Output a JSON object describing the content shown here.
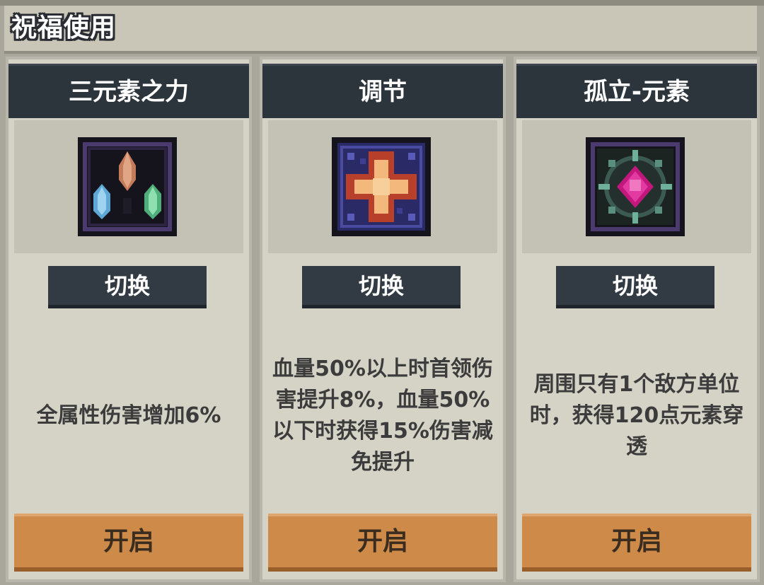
{
  "header": {
    "title": "祝福使用"
  },
  "colors": {
    "background": "#a9a79c",
    "card_header": "#2c343c",
    "switch_button": "#323a43",
    "open_button": "#cd8a48"
  },
  "cards": [
    {
      "title": "三元素之力",
      "icon": "three-elements-crystal-icon",
      "switch_label": "切换",
      "description": "全属性伤害增加6%",
      "open_label": "开启"
    },
    {
      "title": "调节",
      "icon": "regulation-cross-icon",
      "switch_label": "切换",
      "description": "血量50%以上时首领伤害提升8%，血量50%以下时获得15%伤害减免提升",
      "open_label": "开启"
    },
    {
      "title": "孤立-元素",
      "icon": "isolated-element-gem-icon",
      "switch_label": "切换",
      "description": "周围只有1个敌方单位时，获得120点元素穿透",
      "open_label": "开启"
    }
  ]
}
